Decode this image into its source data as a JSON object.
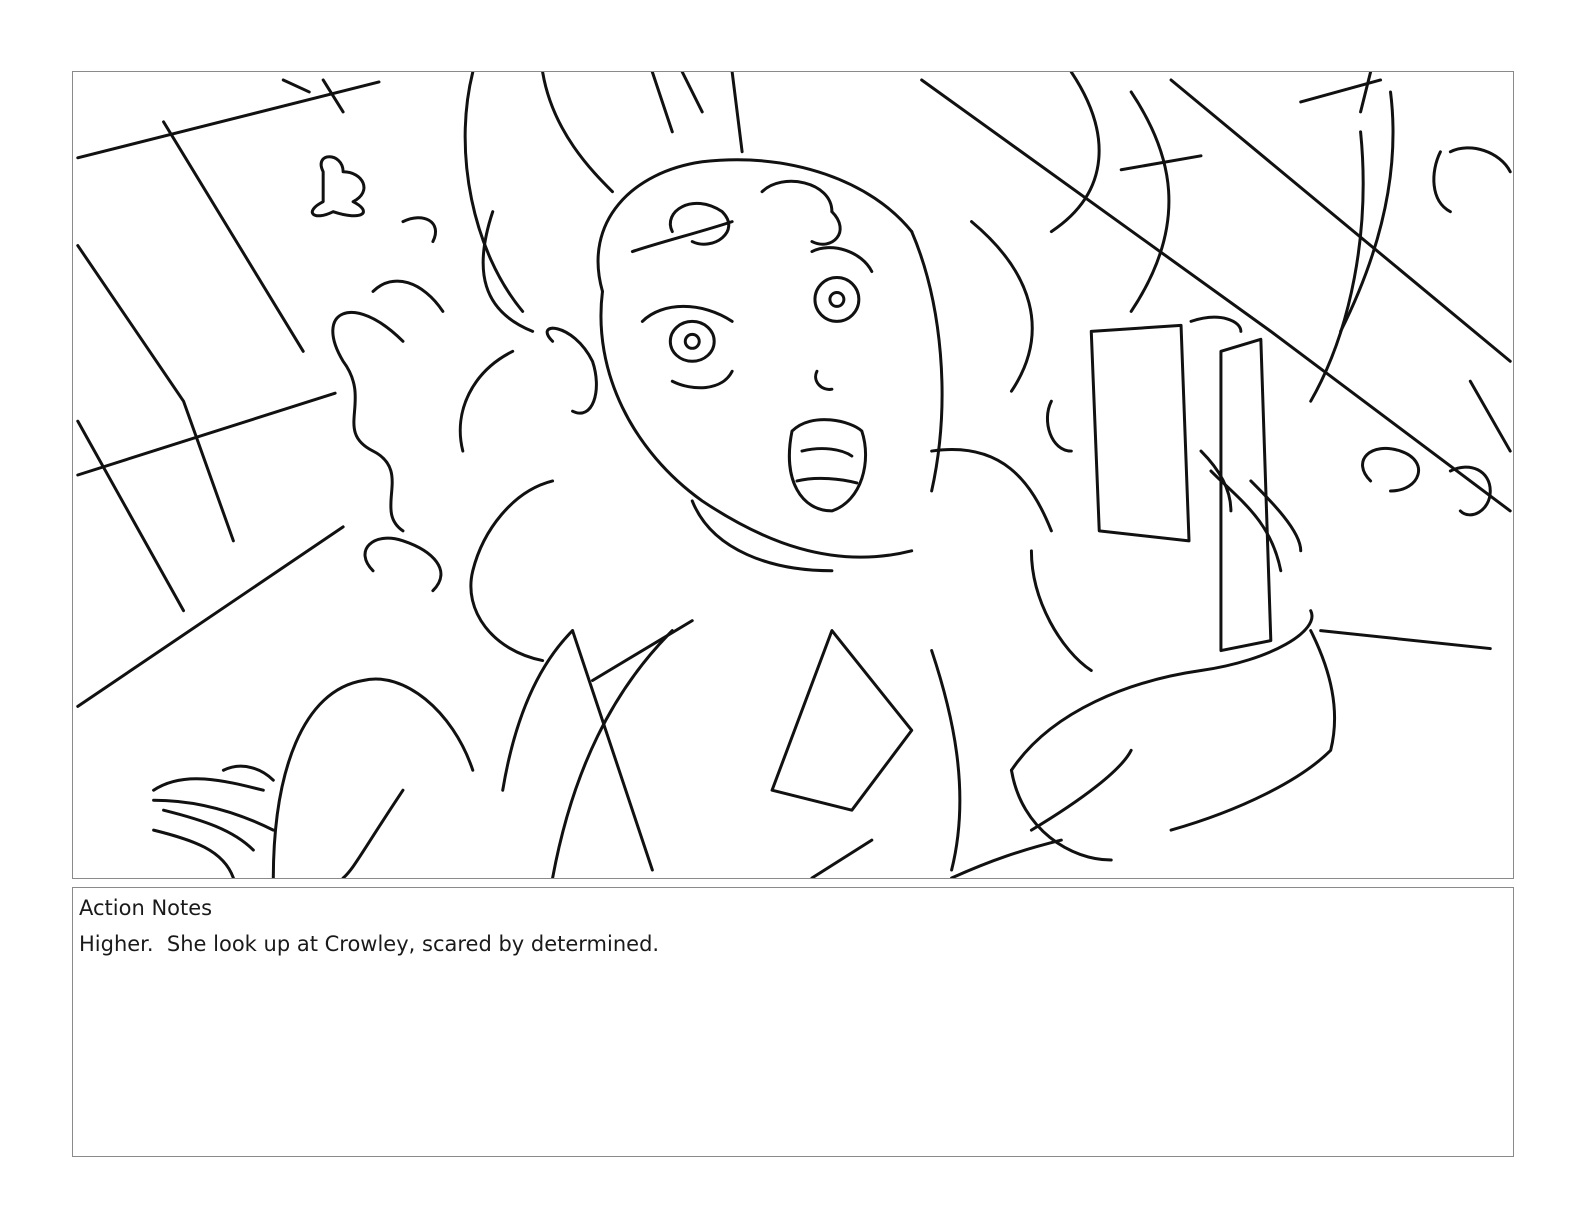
{
  "storyboard_panel": {
    "image_description_icon": "storyboard-sketch",
    "line_color": "#111111"
  },
  "notes": {
    "heading": "Action Notes",
    "body": "Higher.  She look up at Crowley, scared by determined."
  },
  "colors": {
    "border": "#8a8a8a",
    "text": "#1a1a1a",
    "background": "#ffffff"
  }
}
